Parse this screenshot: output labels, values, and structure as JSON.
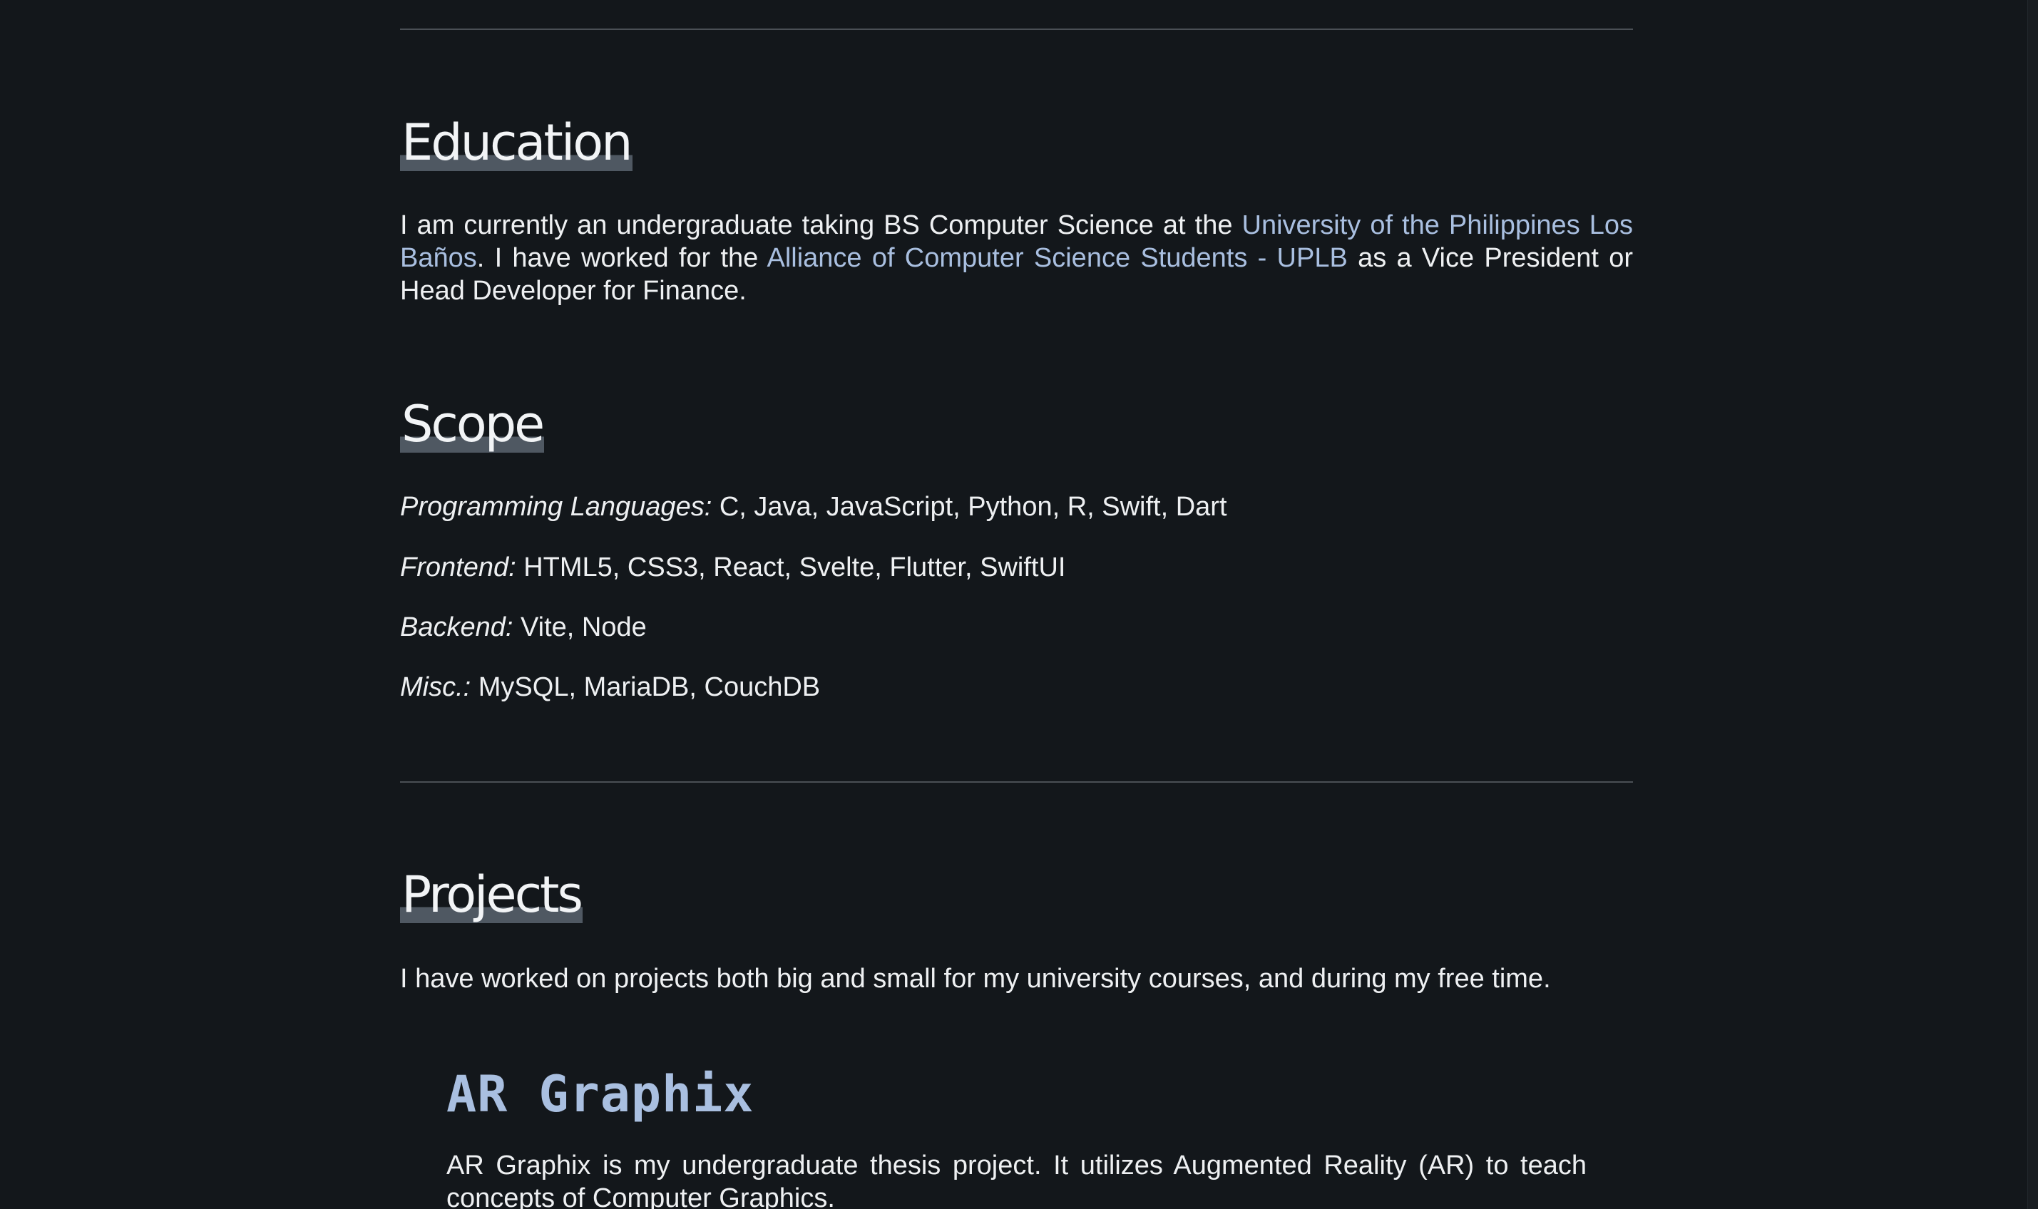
{
  "education": {
    "heading": "Education",
    "text_1": "I am currently an undergraduate taking BS Computer Science at the ",
    "link_uplb": "University of the Philippines Los Baños",
    "text_2": ". I have worked for the ",
    "link_acss": "Alliance of Computer Science Students - UPLB",
    "text_3": " as a Vice President or Head Developer for Finance."
  },
  "scope": {
    "heading": "Scope",
    "items": [
      {
        "label": "Programming Languages:",
        "value": " C, Java, JavaScript, Python, R, Swift, Dart"
      },
      {
        "label": "Frontend:",
        "value": " HTML5, CSS3, React, Svelte, Flutter, SwiftUI"
      },
      {
        "label": "Backend:",
        "value": " Vite, Node"
      },
      {
        "label": "Misc.:",
        "value": " MySQL, MariaDB, CouchDB"
      }
    ]
  },
  "projects": {
    "heading": "Projects",
    "intro": "I have worked on projects both big and small for my university courses, and during my free time.",
    "items": [
      {
        "title": "AR Graphix",
        "description": "AR Graphix is my undergraduate thesis project. It utilizes Augmented Reality (AR) to teach concepts of Computer Graphics."
      }
    ]
  },
  "colors": {
    "background": "#13171b",
    "text": "#eef0f2",
    "link": "#a9bfe0",
    "heading_highlight": "#4f5862",
    "rule": "#4a4f55"
  }
}
